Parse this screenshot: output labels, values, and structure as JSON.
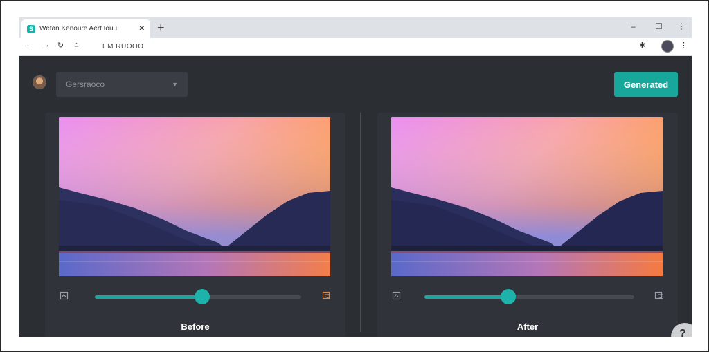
{
  "browser": {
    "tab_title": "Wetan Kenoure Aert Iouu",
    "tab_close": "✕",
    "new_tab": "+",
    "window_controls": [
      "–",
      "☐",
      "⋮"
    ],
    "url": "EM RUOOO"
  },
  "header": {
    "preset_value": "Gersraoco",
    "generate_label": "Generated"
  },
  "panels": [
    {
      "caption": "Before",
      "slider": 0.52
    },
    {
      "caption": "After",
      "slider": 0.4
    }
  ],
  "help_label": "?",
  "colors": {
    "accent": "#17a89b",
    "bg": "#2b2e33",
    "panel": "#303339"
  }
}
